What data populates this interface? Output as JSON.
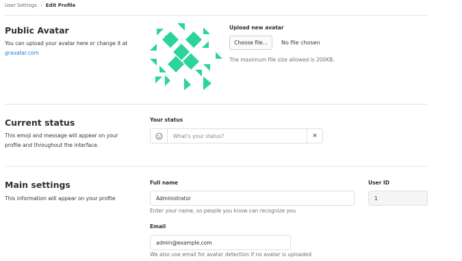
{
  "breadcrumb": {
    "parent": "User Settings",
    "separator": "›",
    "current": "Edit Profile"
  },
  "avatar_section": {
    "title": "Public Avatar",
    "description_prefix": "You can upload your avatar here or change it at",
    "link_text": "gravatar.com",
    "upload_label": "Upload new avatar",
    "choose_button": "Choose file...",
    "file_status": "No file chosen",
    "max_size_note": "The maximum file size allowed is 200KB.",
    "identicon_color": "#2ad49c"
  },
  "status_section": {
    "title": "Current status",
    "description": "This emoji and message will appear on your profile and throughout the interface.",
    "field_label": "Your status",
    "placeholder": "What's your status?",
    "emoji_icon": "smiley-face-icon",
    "clear_icon": "close-icon",
    "clear_glyph": "×"
  },
  "main_section": {
    "title": "Main settings",
    "description": "This information will appear on your profile",
    "full_name_label": "Full name",
    "full_name_value": "Administrator",
    "full_name_help": "Enter your name, so people you know can recognize you",
    "user_id_label": "User ID",
    "user_id_value": "1",
    "email_label": "Email",
    "email_value": "admin@example.com",
    "email_help": "We also use email for avatar detection if no avatar is uploaded"
  }
}
